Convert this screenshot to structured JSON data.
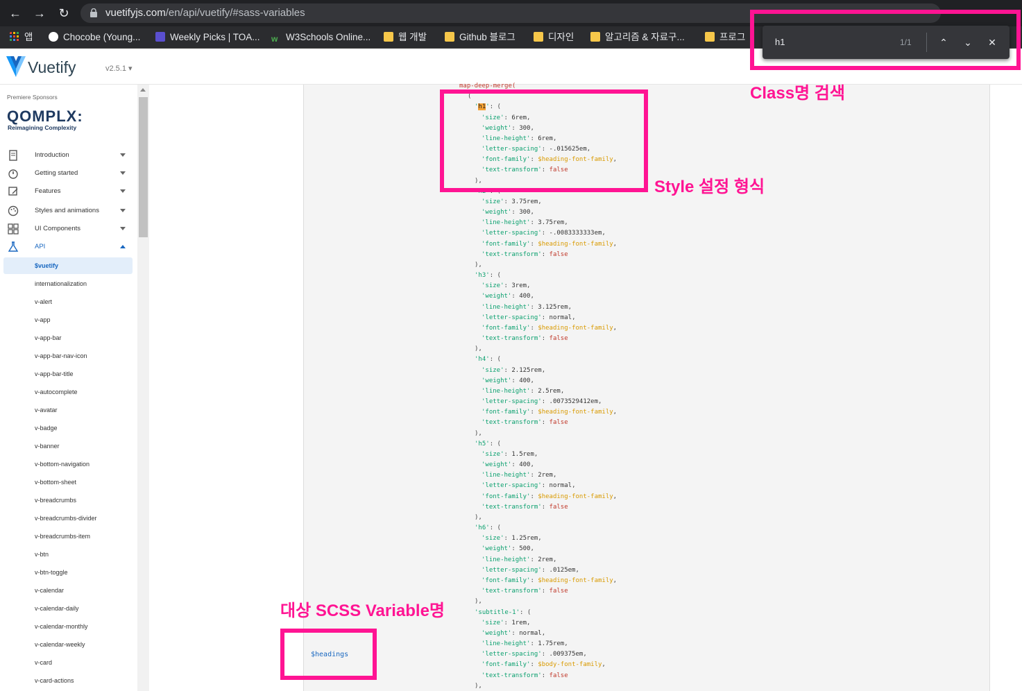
{
  "browser": {
    "url_host": "vuetifyjs.com",
    "url_path": "/en/api/vuetify/#sass-variables",
    "bookmarks": [
      {
        "label": "앱",
        "icon": "apps-grid-icon"
      },
      {
        "label": "Chocobe (Young...",
        "icon": "github-icon"
      },
      {
        "label": "Weekly Picks | TOA...",
        "icon": "ui-icon"
      },
      {
        "label": "W3Schools Online...",
        "icon": "w3schools-icon"
      },
      {
        "label": "웹 개발",
        "icon": "folder-icon"
      },
      {
        "label": "Github 블로그",
        "icon": "folder-icon"
      },
      {
        "label": "디자인",
        "icon": "folder-icon"
      },
      {
        "label": "알고리즘 & 자료구...",
        "icon": "folder-icon"
      },
      {
        "label": "프로그",
        "icon": "folder-icon"
      }
    ]
  },
  "find_bar": {
    "query": "h1",
    "count": "1/1"
  },
  "header": {
    "logo": "Vuetify",
    "version": "v2.5.1"
  },
  "sidebar": {
    "sponsor_label": "Premiere Sponsors",
    "sponsor_name": "QOMPLX:",
    "sponsor_tagline": "Reimagining Complexity",
    "groups": [
      {
        "label": "Introduction",
        "icon": "book-icon"
      },
      {
        "label": "Getting started",
        "icon": "speedometer-icon"
      },
      {
        "label": "Features",
        "icon": "edit-icon"
      },
      {
        "label": "Styles and animations",
        "icon": "palette-icon"
      },
      {
        "label": "UI Components",
        "icon": "grid-icon"
      },
      {
        "label": "API",
        "icon": "flask-icon"
      }
    ],
    "items": [
      "$vuetify",
      "internationalization",
      "v-alert",
      "v-app",
      "v-app-bar",
      "v-app-bar-nav-icon",
      "v-app-bar-title",
      "v-autocomplete",
      "v-avatar",
      "v-badge",
      "v-banner",
      "v-bottom-navigation",
      "v-bottom-sheet",
      "v-breadcrumbs",
      "v-breadcrumbs-divider",
      "v-breadcrumbs-item",
      "v-btn",
      "v-btn-toggle",
      "v-calendar",
      "v-calendar-daily",
      "v-calendar-monthly",
      "v-calendar-weekly",
      "v-card",
      "v-card-actions"
    ]
  },
  "code": {
    "top_line": "map-deep-merge(",
    "headings": [
      {
        "key": "'h1'",
        "size": "6rem",
        "weight": "300",
        "line_height": "6rem",
        "letter_spacing": "-.015625em",
        "font_family": "$heading-font-family"
      },
      {
        "key": "'h2'",
        "size": "3.75rem",
        "weight": "300",
        "line_height": "3.75rem",
        "letter_spacing": "-.0083333333em",
        "font_family": "$heading-font-family"
      },
      {
        "key": "'h3'",
        "size": "3rem",
        "weight": "400",
        "line_height": "3.125rem",
        "letter_spacing": "normal",
        "font_family": "$heading-font-family"
      },
      {
        "key": "'h4'",
        "size": "2.125rem",
        "weight": "400",
        "line_height": "2.5rem",
        "letter_spacing": ".0073529412em",
        "font_family": "$heading-font-family"
      },
      {
        "key": "'h5'",
        "size": "1.5rem",
        "weight": "400",
        "line_height": "2rem",
        "letter_spacing": "normal",
        "font_family": "$heading-font-family"
      },
      {
        "key": "'h6'",
        "size": "1.25rem",
        "weight": "500",
        "line_height": "2rem",
        "letter_spacing": ".0125em",
        "font_family": "$heading-font-family"
      },
      {
        "key": "'subtitle-1'",
        "size": "1rem",
        "weight": "normal",
        "line_height": "1.75rem",
        "letter_spacing": ".009375em",
        "font_family": "$body-font-family"
      }
    ],
    "text_transform": "false",
    "variable_name": "$headings"
  },
  "annotations": {
    "class_search": "Class명 검색",
    "style_format": "Style 설정 형식",
    "scss_variable": "대상 SCSS Variable명"
  },
  "colors": {
    "highlight": "#ff1493",
    "accent": "#1867c0"
  }
}
